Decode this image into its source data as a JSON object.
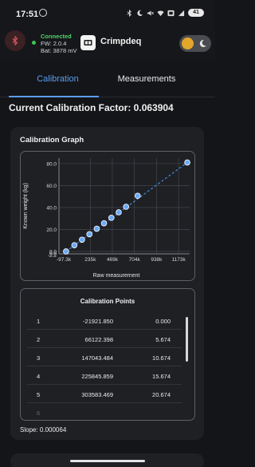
{
  "status_bar": {
    "time": "17:51",
    "battery": "41",
    "icons": [
      "whatsapp-icon",
      "bluetooth-icon",
      "moon-icon",
      "mute-icon",
      "wifi-icon",
      "volte-icon",
      "signal-icon",
      "battery-icon"
    ]
  },
  "header": {
    "connection_status": "Connected",
    "firmware": "FW: 2.0.4",
    "battery": "Bat: 3878 mV",
    "app_name": "Crimpdeq",
    "colors": {
      "connected": "#3cc553",
      "bluetooth_bg": "#3a2124",
      "toggle_knob": "#e3a72a"
    }
  },
  "tabs": [
    {
      "label": "Calibration",
      "active": true
    },
    {
      "label": "Measurements",
      "active": false
    }
  ],
  "calibration": {
    "factor_label": "Current Calibration Factor: 0.063904",
    "graph_title": "Calibration Graph",
    "points_title": "Calibration Points",
    "slope_label": "Slope: 0.000064",
    "points": [
      {
        "index": "1",
        "raw": "-21921.850",
        "kg": "0.000"
      },
      {
        "index": "2",
        "raw": "66122.398",
        "kg": "5.674"
      },
      {
        "index": "3",
        "raw": "147043.484",
        "kg": "10.674"
      },
      {
        "index": "4",
        "raw": "225845.859",
        "kg": "15.674"
      },
      {
        "index": "5",
        "raw": "303583.469",
        "kg": "20.674"
      },
      {
        "index": "6",
        "raw": "",
        "kg": ""
      }
    ]
  },
  "chart_data": {
    "type": "scatter",
    "title": "",
    "xlabel": "Raw measurement",
    "ylabel": "Known weight (kg)",
    "xlim": [
      -97300,
      1290000
    ],
    "ylim": [
      -2.2,
      85
    ],
    "x_ticks": [
      {
        "value": -97300,
        "label": "-97.3k"
      },
      {
        "value": 235000,
        "label": "235k"
      },
      {
        "value": 469000,
        "label": "469k"
      },
      {
        "value": 704000,
        "label": "704k"
      },
      {
        "value": 938000,
        "label": "938k"
      },
      {
        "value": 1173000,
        "label": "1173k"
      }
    ],
    "y_ticks": [
      {
        "value": -2.2,
        "label": "-2.2"
      },
      {
        "value": 0,
        "label": "0.0"
      },
      {
        "value": 20,
        "label": "20.0"
      },
      {
        "value": 40,
        "label": "40.0"
      },
      {
        "value": 60,
        "label": "60.0"
      },
      {
        "value": 80,
        "label": "80.0"
      }
    ],
    "x_start_label": "0.0",
    "x": [
      -21921.85,
      66122.398,
      147043.484,
      225845.859,
      303583.469,
      381000,
      459000,
      537000,
      615000,
      738000,
      1265000
    ],
    "y": [
      0,
      5.674,
      10.674,
      15.674,
      20.674,
      25.674,
      30.674,
      35.674,
      40.674,
      50.674,
      81.0
    ],
    "fit_line": {
      "slope": 6.4e-05,
      "style": "dashed"
    },
    "grid": true,
    "colors": {
      "points": "#6aa9f5",
      "line": "#3f8fe8",
      "grid": "#4a4c52",
      "axis": "#9a9ca2"
    }
  }
}
